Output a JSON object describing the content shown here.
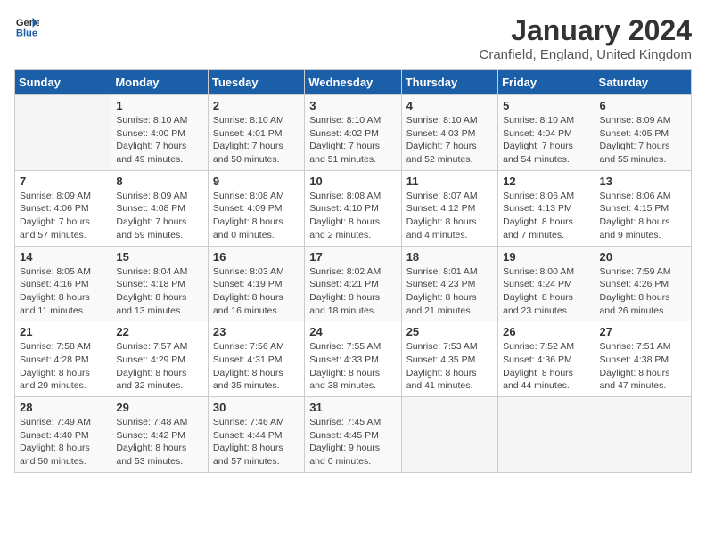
{
  "logo": {
    "general": "General",
    "blue": "Blue"
  },
  "header": {
    "month_year": "January 2024",
    "location": "Cranfield, England, United Kingdom"
  },
  "weekdays": [
    "Sunday",
    "Monday",
    "Tuesday",
    "Wednesday",
    "Thursday",
    "Friday",
    "Saturday"
  ],
  "weeks": [
    [
      {
        "day": "",
        "sunrise": "",
        "sunset": "",
        "daylight": ""
      },
      {
        "day": "1",
        "sunrise": "Sunrise: 8:10 AM",
        "sunset": "Sunset: 4:00 PM",
        "daylight": "Daylight: 7 hours and 49 minutes."
      },
      {
        "day": "2",
        "sunrise": "Sunrise: 8:10 AM",
        "sunset": "Sunset: 4:01 PM",
        "daylight": "Daylight: 7 hours and 50 minutes."
      },
      {
        "day": "3",
        "sunrise": "Sunrise: 8:10 AM",
        "sunset": "Sunset: 4:02 PM",
        "daylight": "Daylight: 7 hours and 51 minutes."
      },
      {
        "day": "4",
        "sunrise": "Sunrise: 8:10 AM",
        "sunset": "Sunset: 4:03 PM",
        "daylight": "Daylight: 7 hours and 52 minutes."
      },
      {
        "day": "5",
        "sunrise": "Sunrise: 8:10 AM",
        "sunset": "Sunset: 4:04 PM",
        "daylight": "Daylight: 7 hours and 54 minutes."
      },
      {
        "day": "6",
        "sunrise": "Sunrise: 8:09 AM",
        "sunset": "Sunset: 4:05 PM",
        "daylight": "Daylight: 7 hours and 55 minutes."
      }
    ],
    [
      {
        "day": "7",
        "sunrise": "Sunrise: 8:09 AM",
        "sunset": "Sunset: 4:06 PM",
        "daylight": "Daylight: 7 hours and 57 minutes."
      },
      {
        "day": "8",
        "sunrise": "Sunrise: 8:09 AM",
        "sunset": "Sunset: 4:08 PM",
        "daylight": "Daylight: 7 hours and 59 minutes."
      },
      {
        "day": "9",
        "sunrise": "Sunrise: 8:08 AM",
        "sunset": "Sunset: 4:09 PM",
        "daylight": "Daylight: 8 hours and 0 minutes."
      },
      {
        "day": "10",
        "sunrise": "Sunrise: 8:08 AM",
        "sunset": "Sunset: 4:10 PM",
        "daylight": "Daylight: 8 hours and 2 minutes."
      },
      {
        "day": "11",
        "sunrise": "Sunrise: 8:07 AM",
        "sunset": "Sunset: 4:12 PM",
        "daylight": "Daylight: 8 hours and 4 minutes."
      },
      {
        "day": "12",
        "sunrise": "Sunrise: 8:06 AM",
        "sunset": "Sunset: 4:13 PM",
        "daylight": "Daylight: 8 hours and 7 minutes."
      },
      {
        "day": "13",
        "sunrise": "Sunrise: 8:06 AM",
        "sunset": "Sunset: 4:15 PM",
        "daylight": "Daylight: 8 hours and 9 minutes."
      }
    ],
    [
      {
        "day": "14",
        "sunrise": "Sunrise: 8:05 AM",
        "sunset": "Sunset: 4:16 PM",
        "daylight": "Daylight: 8 hours and 11 minutes."
      },
      {
        "day": "15",
        "sunrise": "Sunrise: 8:04 AM",
        "sunset": "Sunset: 4:18 PM",
        "daylight": "Daylight: 8 hours and 13 minutes."
      },
      {
        "day": "16",
        "sunrise": "Sunrise: 8:03 AM",
        "sunset": "Sunset: 4:19 PM",
        "daylight": "Daylight: 8 hours and 16 minutes."
      },
      {
        "day": "17",
        "sunrise": "Sunrise: 8:02 AM",
        "sunset": "Sunset: 4:21 PM",
        "daylight": "Daylight: 8 hours and 18 minutes."
      },
      {
        "day": "18",
        "sunrise": "Sunrise: 8:01 AM",
        "sunset": "Sunset: 4:23 PM",
        "daylight": "Daylight: 8 hours and 21 minutes."
      },
      {
        "day": "19",
        "sunrise": "Sunrise: 8:00 AM",
        "sunset": "Sunset: 4:24 PM",
        "daylight": "Daylight: 8 hours and 23 minutes."
      },
      {
        "day": "20",
        "sunrise": "Sunrise: 7:59 AM",
        "sunset": "Sunset: 4:26 PM",
        "daylight": "Daylight: 8 hours and 26 minutes."
      }
    ],
    [
      {
        "day": "21",
        "sunrise": "Sunrise: 7:58 AM",
        "sunset": "Sunset: 4:28 PM",
        "daylight": "Daylight: 8 hours and 29 minutes."
      },
      {
        "day": "22",
        "sunrise": "Sunrise: 7:57 AM",
        "sunset": "Sunset: 4:29 PM",
        "daylight": "Daylight: 8 hours and 32 minutes."
      },
      {
        "day": "23",
        "sunrise": "Sunrise: 7:56 AM",
        "sunset": "Sunset: 4:31 PM",
        "daylight": "Daylight: 8 hours and 35 minutes."
      },
      {
        "day": "24",
        "sunrise": "Sunrise: 7:55 AM",
        "sunset": "Sunset: 4:33 PM",
        "daylight": "Daylight: 8 hours and 38 minutes."
      },
      {
        "day": "25",
        "sunrise": "Sunrise: 7:53 AM",
        "sunset": "Sunset: 4:35 PM",
        "daylight": "Daylight: 8 hours and 41 minutes."
      },
      {
        "day": "26",
        "sunrise": "Sunrise: 7:52 AM",
        "sunset": "Sunset: 4:36 PM",
        "daylight": "Daylight: 8 hours and 44 minutes."
      },
      {
        "day": "27",
        "sunrise": "Sunrise: 7:51 AM",
        "sunset": "Sunset: 4:38 PM",
        "daylight": "Daylight: 8 hours and 47 minutes."
      }
    ],
    [
      {
        "day": "28",
        "sunrise": "Sunrise: 7:49 AM",
        "sunset": "Sunset: 4:40 PM",
        "daylight": "Daylight: 8 hours and 50 minutes."
      },
      {
        "day": "29",
        "sunrise": "Sunrise: 7:48 AM",
        "sunset": "Sunset: 4:42 PM",
        "daylight": "Daylight: 8 hours and 53 minutes."
      },
      {
        "day": "30",
        "sunrise": "Sunrise: 7:46 AM",
        "sunset": "Sunset: 4:44 PM",
        "daylight": "Daylight: 8 hours and 57 minutes."
      },
      {
        "day": "31",
        "sunrise": "Sunrise: 7:45 AM",
        "sunset": "Sunset: 4:45 PM",
        "daylight": "Daylight: 9 hours and 0 minutes."
      },
      {
        "day": "",
        "sunrise": "",
        "sunset": "",
        "daylight": ""
      },
      {
        "day": "",
        "sunrise": "",
        "sunset": "",
        "daylight": ""
      },
      {
        "day": "",
        "sunrise": "",
        "sunset": "",
        "daylight": ""
      }
    ]
  ]
}
